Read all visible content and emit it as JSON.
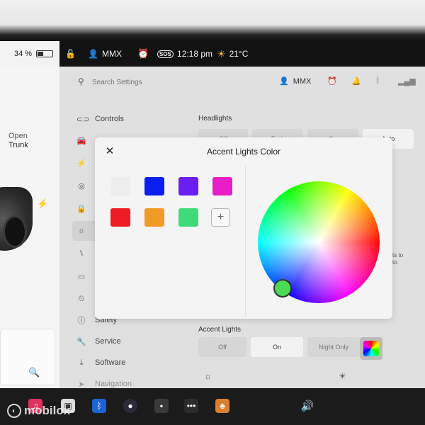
{
  "status_bar": {
    "battery_percent": "34 %",
    "battery_level": 0.34,
    "profile": "MMX",
    "sos": "SOS",
    "time": "12:18 pm",
    "temperature": "21°C"
  },
  "vehicle_panel": {
    "trunk_action": "Open",
    "trunk_label": "Trunk"
  },
  "settings": {
    "search_placeholder": "Search Settings",
    "user": "MMX",
    "nav": [
      {
        "label": "Controls",
        "icon": "toggle-icon"
      },
      {
        "label": "",
        "icon": "car-icon"
      },
      {
        "label": "",
        "icon": "lightning-icon"
      },
      {
        "label": "",
        "icon": "steering-wheel-icon"
      },
      {
        "label": "",
        "icon": "lock-icon"
      },
      {
        "label": "",
        "icon": "lights-icon"
      },
      {
        "label": "",
        "icon": "seat-icon"
      },
      {
        "label": "",
        "icon": "display-icon"
      },
      {
        "label": "",
        "icon": "schedule-icon"
      },
      {
        "label": "Safety",
        "icon": "info-icon"
      },
      {
        "label": "Service",
        "icon": "wrench-icon"
      },
      {
        "label": "Software",
        "icon": "download-icon"
      },
      {
        "label": "Navigation",
        "icon": "navigation-icon"
      }
    ],
    "headlights_title": "Headlights",
    "headlights_options": [
      "Off",
      "Park",
      "On",
      "Auto"
    ],
    "accent_title": "Accent Lights",
    "accent_options": [
      "Off",
      "On",
      "Night Only"
    ],
    "accent_selected": "On",
    "side_note": "ts to\nto"
  },
  "modal": {
    "title": "Accent Lights Color",
    "close_label": "✕",
    "add_label": "+",
    "swatches": [
      {
        "name": "white",
        "color": "#eeeeee"
      },
      {
        "name": "blue",
        "color": "#0a1ef0"
      },
      {
        "name": "purple",
        "color": "#6a1ef2"
      },
      {
        "name": "magenta",
        "color": "#e81ec8"
      },
      {
        "name": "red",
        "color": "#ee1c24"
      },
      {
        "name": "orange",
        "color": "#f09a28"
      },
      {
        "name": "green",
        "color": "#3edc78"
      }
    ],
    "selected_color": "#4bdc54"
  },
  "taskbar": {
    "volume_icon": "volume-icon",
    "icons": [
      "music-icon",
      "dashcam-icon",
      "bluetooth-icon",
      "camera-icon",
      "toybox-icon",
      "more-icon",
      "games-icon"
    ]
  },
  "watermark": "mobilox"
}
